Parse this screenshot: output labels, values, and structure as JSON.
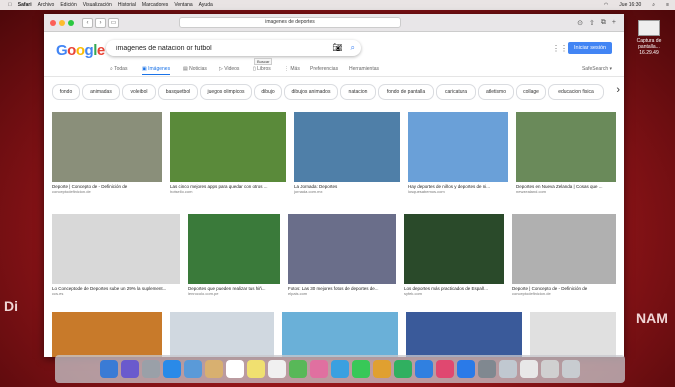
{
  "menubar": {
    "items": [
      "Safari",
      "Archivo",
      "Edición",
      "Visualización",
      "Historial",
      "Marcadores",
      "Ventana",
      "Ayuda"
    ],
    "clock": "Jue 16:30"
  },
  "desktop": {
    "icon_label": "Captura de pantalla... 16.29.49",
    "wallpaper_text_left": "Di",
    "wallpaper_text_right": "NAM"
  },
  "browser": {
    "url": "imagenes de deportes"
  },
  "google": {
    "logo": "Google",
    "query": "imagenes de natacion or futbol",
    "tooltip": "Buscar",
    "signin_label": "Iniciar sesión",
    "tabs": [
      "Todas",
      "Imágenes",
      "Noticias",
      "Videos",
      "Libros",
      "Más",
      "Preferencias",
      "Herramientas"
    ],
    "safesearch": "SafeSearch ▾"
  },
  "chips": [
    "fondo",
    "animadas",
    "voleibol",
    "basquetbol",
    "juegos olimpicos",
    "dibujo",
    "dibujos animados",
    "natacion",
    "fondo de pantalla",
    "caricatura",
    "atletismo",
    "collage",
    "educacion fisica"
  ],
  "results": [
    {
      "caption": "Deporte | Concepto de - Definición de",
      "source": "conceptodefinicion.de",
      "color": "#8a8f7a"
    },
    {
      "caption": "Las cinco mejores apps para quedar con otros ...",
      "source": "hotsello.com",
      "color": "#5a8a3a"
    },
    {
      "caption": "La Jornada: Deportes",
      "source": "jornada.com.mx",
      "color": "#4f7fa8"
    },
    {
      "caption": "Hay deportes de niños y deportes de ni...",
      "source": "losquesabemos.com",
      "color": "#6aa0d8"
    },
    {
      "caption": "Deportes en Nueva Zelanda | Cosas que ...",
      "source": "newzealand.com",
      "color": "#6a8a5a"
    },
    {
      "caption": "Lo Conceptode de Deportes sube un 29% la suplement...",
      "source": "ccs.es",
      "color": "#d8d8d8"
    },
    {
      "caption": "Deportes que pueden realizar tus hiñ...",
      "source": "lenrocolo.com.pe",
      "color": "#3a7a3a"
    },
    {
      "caption": "Fotos: Las 30 mejores fotos de deportes de...",
      "source": "elpais.com",
      "color": "#6a6e8a"
    },
    {
      "caption": "Los deportes más practicados de Españ...",
      "source": "syfek.com",
      "color": "#2a4a2a"
    },
    {
      "caption": "Deporte | Concepto de - Definición de",
      "source": "conceptodefinicion.de",
      "color": "#b0b0b0"
    },
    {
      "caption": "",
      "source": "",
      "color": "#c87a2a"
    },
    {
      "caption": "",
      "source": "",
      "color": "#d0d8e0"
    },
    {
      "caption": "",
      "source": "",
      "color": "#6ab0d8"
    },
    {
      "caption": "",
      "source": "",
      "color": "#3a5a9a"
    },
    {
      "caption": "",
      "source": "",
      "color": "#e0e0e0"
    }
  ]
}
